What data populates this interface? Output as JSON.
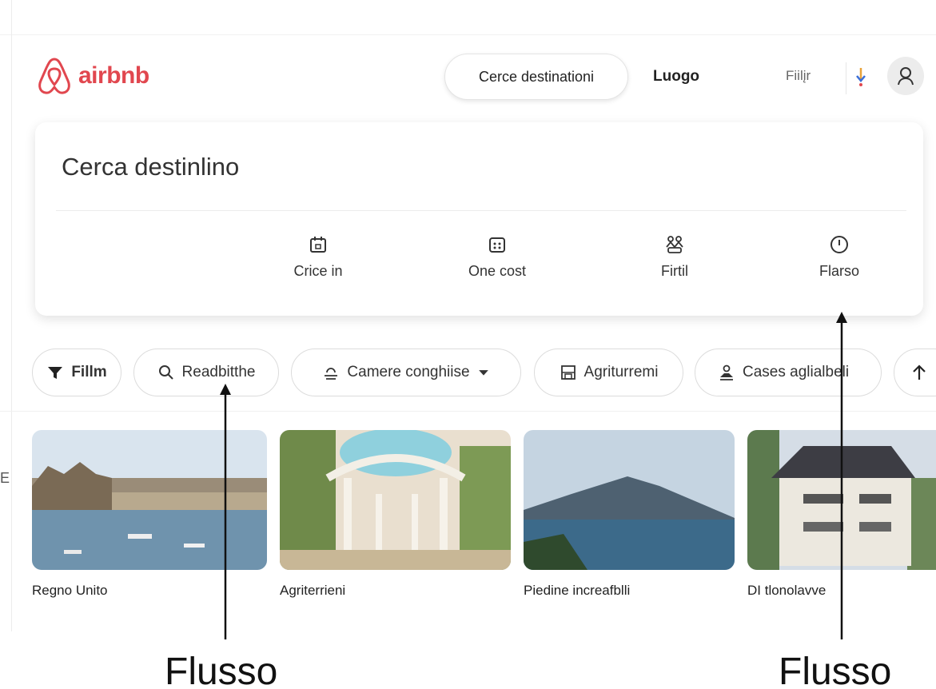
{
  "brand": {
    "name": "airbnb",
    "color": "#e1474f"
  },
  "header": {
    "search_pill": "Cerce destinationi",
    "nav_luogo": "Luogo",
    "nav_filtri": "Fiilįr"
  },
  "search_card": {
    "title": "Cerca destinlino",
    "options": [
      {
        "label": "Crice in",
        "icon": "calendar-icon"
      },
      {
        "label": "One cost",
        "icon": "calendar-grid-icon"
      },
      {
        "label": "Firtil",
        "icon": "people-icon"
      },
      {
        "label": "Flarso",
        "icon": "clock-icon"
      }
    ]
  },
  "chips": [
    {
      "label": "Fillm",
      "icon": "filter-icon"
    },
    {
      "label": "Readbitthe",
      "icon": "search-icon"
    },
    {
      "label": "Camere conghiise",
      "icon": "bed-icon"
    },
    {
      "label": "Agriturremi",
      "icon": "building-icon"
    },
    {
      "label": "Cases aglialbeli",
      "icon": "house-icon"
    },
    {
      "label": "",
      "icon": "arrow-up-icon"
    }
  ],
  "listings": [
    {
      "label": "Regno Unito"
    },
    {
      "label": "Agriterrieni"
    },
    {
      "label": "Piedine increafblli"
    },
    {
      "label": "DI tlonolavve"
    }
  ],
  "annotations": {
    "left": "Flusso",
    "right": "Flusso"
  },
  "left_edge_mark": "E"
}
